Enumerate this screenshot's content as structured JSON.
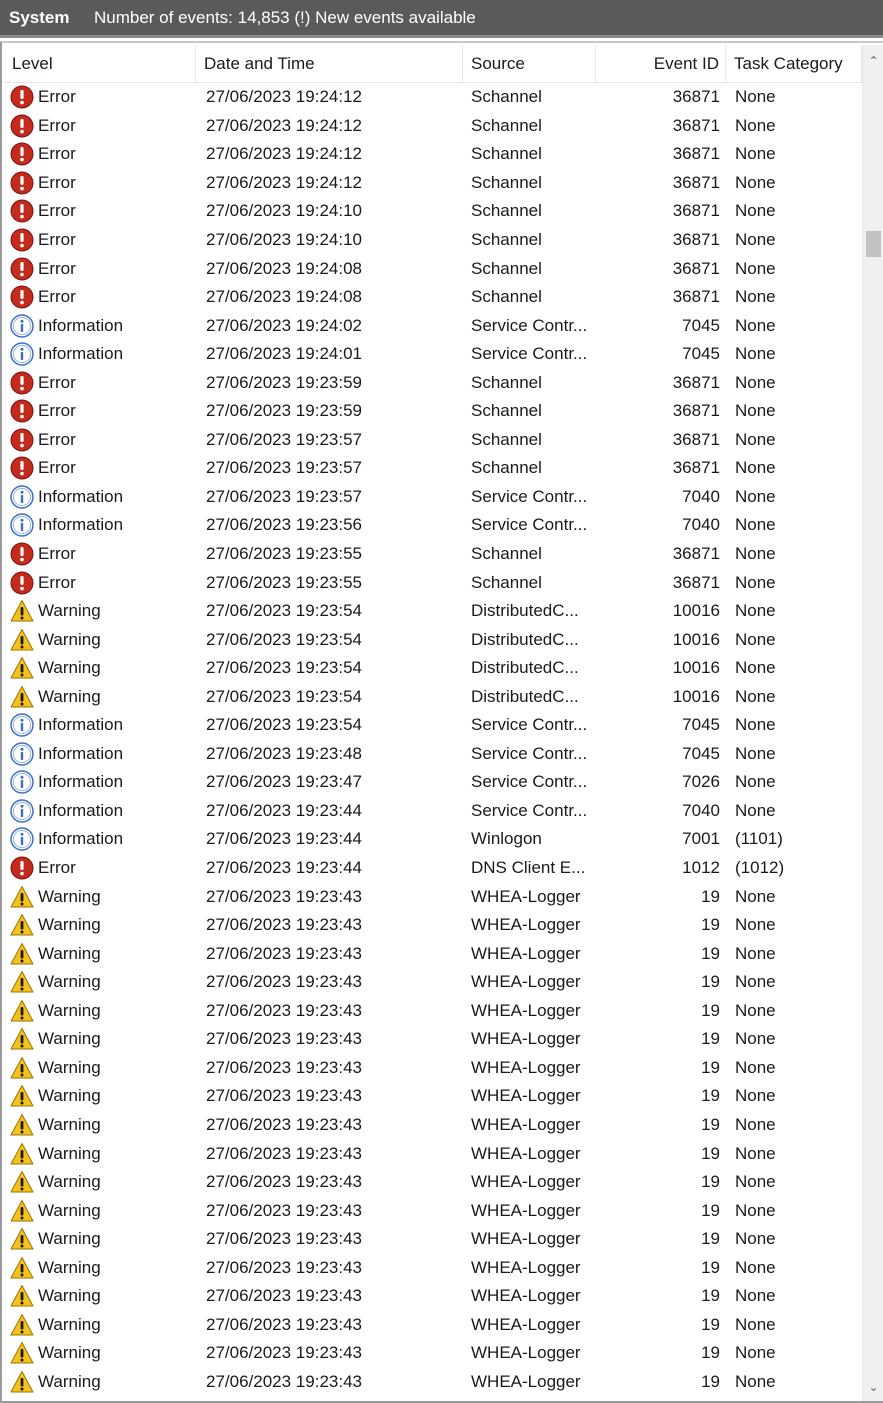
{
  "header": {
    "log_name": "System",
    "event_count": "Number of events: 14,853 (!) New events available"
  },
  "columns": {
    "level": "Level",
    "date": "Date and Time",
    "source": "Source",
    "event_id": "Event ID",
    "category": "Task Category"
  },
  "icons": {
    "error": "error-icon",
    "information": "information-icon",
    "warning": "warning-icon"
  },
  "colors": {
    "error": "#c42b1c",
    "information": "#3a6fc4",
    "warning": "#f5c21b",
    "titlebar": "#5a5a5a"
  },
  "scrollbar": {
    "up": "⌃",
    "down": "⌄"
  },
  "rows": [
    {
      "level": "Error",
      "type": "error",
      "date": "27/06/2023 19:24:12",
      "source": "Schannel",
      "id": "36871",
      "category": "None"
    },
    {
      "level": "Error",
      "type": "error",
      "date": "27/06/2023 19:24:12",
      "source": "Schannel",
      "id": "36871",
      "category": "None"
    },
    {
      "level": "Error",
      "type": "error",
      "date": "27/06/2023 19:24:12",
      "source": "Schannel",
      "id": "36871",
      "category": "None"
    },
    {
      "level": "Error",
      "type": "error",
      "date": "27/06/2023 19:24:12",
      "source": "Schannel",
      "id": "36871",
      "category": "None"
    },
    {
      "level": "Error",
      "type": "error",
      "date": "27/06/2023 19:24:10",
      "source": "Schannel",
      "id": "36871",
      "category": "None"
    },
    {
      "level": "Error",
      "type": "error",
      "date": "27/06/2023 19:24:10",
      "source": "Schannel",
      "id": "36871",
      "category": "None"
    },
    {
      "level": "Error",
      "type": "error",
      "date": "27/06/2023 19:24:08",
      "source": "Schannel",
      "id": "36871",
      "category": "None"
    },
    {
      "level": "Error",
      "type": "error",
      "date": "27/06/2023 19:24:08",
      "source": "Schannel",
      "id": "36871",
      "category": "None"
    },
    {
      "level": "Information",
      "type": "information",
      "date": "27/06/2023 19:24:02",
      "source": "Service Contr...",
      "id": "7045",
      "category": "None"
    },
    {
      "level": "Information",
      "type": "information",
      "date": "27/06/2023 19:24:01",
      "source": "Service Contr...",
      "id": "7045",
      "category": "None"
    },
    {
      "level": "Error",
      "type": "error",
      "date": "27/06/2023 19:23:59",
      "source": "Schannel",
      "id": "36871",
      "category": "None"
    },
    {
      "level": "Error",
      "type": "error",
      "date": "27/06/2023 19:23:59",
      "source": "Schannel",
      "id": "36871",
      "category": "None"
    },
    {
      "level": "Error",
      "type": "error",
      "date": "27/06/2023 19:23:57",
      "source": "Schannel",
      "id": "36871",
      "category": "None"
    },
    {
      "level": "Error",
      "type": "error",
      "date": "27/06/2023 19:23:57",
      "source": "Schannel",
      "id": "36871",
      "category": "None"
    },
    {
      "level": "Information",
      "type": "information",
      "date": "27/06/2023 19:23:57",
      "source": "Service Contr...",
      "id": "7040",
      "category": "None"
    },
    {
      "level": "Information",
      "type": "information",
      "date": "27/06/2023 19:23:56",
      "source": "Service Contr...",
      "id": "7040",
      "category": "None"
    },
    {
      "level": "Error",
      "type": "error",
      "date": "27/06/2023 19:23:55",
      "source": "Schannel",
      "id": "36871",
      "category": "None"
    },
    {
      "level": "Error",
      "type": "error",
      "date": "27/06/2023 19:23:55",
      "source": "Schannel",
      "id": "36871",
      "category": "None"
    },
    {
      "level": "Warning",
      "type": "warning",
      "date": "27/06/2023 19:23:54",
      "source": "DistributedC...",
      "id": "10016",
      "category": "None"
    },
    {
      "level": "Warning",
      "type": "warning",
      "date": "27/06/2023 19:23:54",
      "source": "DistributedC...",
      "id": "10016",
      "category": "None"
    },
    {
      "level": "Warning",
      "type": "warning",
      "date": "27/06/2023 19:23:54",
      "source": "DistributedC...",
      "id": "10016",
      "category": "None"
    },
    {
      "level": "Warning",
      "type": "warning",
      "date": "27/06/2023 19:23:54",
      "source": "DistributedC...",
      "id": "10016",
      "category": "None"
    },
    {
      "level": "Information",
      "type": "information",
      "date": "27/06/2023 19:23:54",
      "source": "Service Contr...",
      "id": "7045",
      "category": "None"
    },
    {
      "level": "Information",
      "type": "information",
      "date": "27/06/2023 19:23:48",
      "source": "Service Contr...",
      "id": "7045",
      "category": "None"
    },
    {
      "level": "Information",
      "type": "information",
      "date": "27/06/2023 19:23:47",
      "source": "Service Contr...",
      "id": "7026",
      "category": "None"
    },
    {
      "level": "Information",
      "type": "information",
      "date": "27/06/2023 19:23:44",
      "source": "Service Contr...",
      "id": "7040",
      "category": "None"
    },
    {
      "level": "Information",
      "type": "information",
      "date": "27/06/2023 19:23:44",
      "source": "Winlogon",
      "id": "7001",
      "category": "(1101)"
    },
    {
      "level": "Error",
      "type": "error",
      "date": "27/06/2023 19:23:44",
      "source": "DNS Client E...",
      "id": "1012",
      "category": "(1012)"
    },
    {
      "level": "Warning",
      "type": "warning",
      "date": "27/06/2023 19:23:43",
      "source": "WHEA-Logger",
      "id": "19",
      "category": "None"
    },
    {
      "level": "Warning",
      "type": "warning",
      "date": "27/06/2023 19:23:43",
      "source": "WHEA-Logger",
      "id": "19",
      "category": "None"
    },
    {
      "level": "Warning",
      "type": "warning",
      "date": "27/06/2023 19:23:43",
      "source": "WHEA-Logger",
      "id": "19",
      "category": "None"
    },
    {
      "level": "Warning",
      "type": "warning",
      "date": "27/06/2023 19:23:43",
      "source": "WHEA-Logger",
      "id": "19",
      "category": "None"
    },
    {
      "level": "Warning",
      "type": "warning",
      "date": "27/06/2023 19:23:43",
      "source": "WHEA-Logger",
      "id": "19",
      "category": "None"
    },
    {
      "level": "Warning",
      "type": "warning",
      "date": "27/06/2023 19:23:43",
      "source": "WHEA-Logger",
      "id": "19",
      "category": "None"
    },
    {
      "level": "Warning",
      "type": "warning",
      "date": "27/06/2023 19:23:43",
      "source": "WHEA-Logger",
      "id": "19",
      "category": "None"
    },
    {
      "level": "Warning",
      "type": "warning",
      "date": "27/06/2023 19:23:43",
      "source": "WHEA-Logger",
      "id": "19",
      "category": "None"
    },
    {
      "level": "Warning",
      "type": "warning",
      "date": "27/06/2023 19:23:43",
      "source": "WHEA-Logger",
      "id": "19",
      "category": "None"
    },
    {
      "level": "Warning",
      "type": "warning",
      "date": "27/06/2023 19:23:43",
      "source": "WHEA-Logger",
      "id": "19",
      "category": "None"
    },
    {
      "level": "Warning",
      "type": "warning",
      "date": "27/06/2023 19:23:43",
      "source": "WHEA-Logger",
      "id": "19",
      "category": "None"
    },
    {
      "level": "Warning",
      "type": "warning",
      "date": "27/06/2023 19:23:43",
      "source": "WHEA-Logger",
      "id": "19",
      "category": "None"
    },
    {
      "level": "Warning",
      "type": "warning",
      "date": "27/06/2023 19:23:43",
      "source": "WHEA-Logger",
      "id": "19",
      "category": "None"
    },
    {
      "level": "Warning",
      "type": "warning",
      "date": "27/06/2023 19:23:43",
      "source": "WHEA-Logger",
      "id": "19",
      "category": "None"
    },
    {
      "level": "Warning",
      "type": "warning",
      "date": "27/06/2023 19:23:43",
      "source": "WHEA-Logger",
      "id": "19",
      "category": "None"
    },
    {
      "level": "Warning",
      "type": "warning",
      "date": "27/06/2023 19:23:43",
      "source": "WHEA-Logger",
      "id": "19",
      "category": "None"
    },
    {
      "level": "Warning",
      "type": "warning",
      "date": "27/06/2023 19:23:43",
      "source": "WHEA-Logger",
      "id": "19",
      "category": "None"
    },
    {
      "level": "Warning",
      "type": "warning",
      "date": "27/06/2023 19:23:43",
      "source": "WHEA-Logger",
      "id": "19",
      "category": "None"
    }
  ]
}
